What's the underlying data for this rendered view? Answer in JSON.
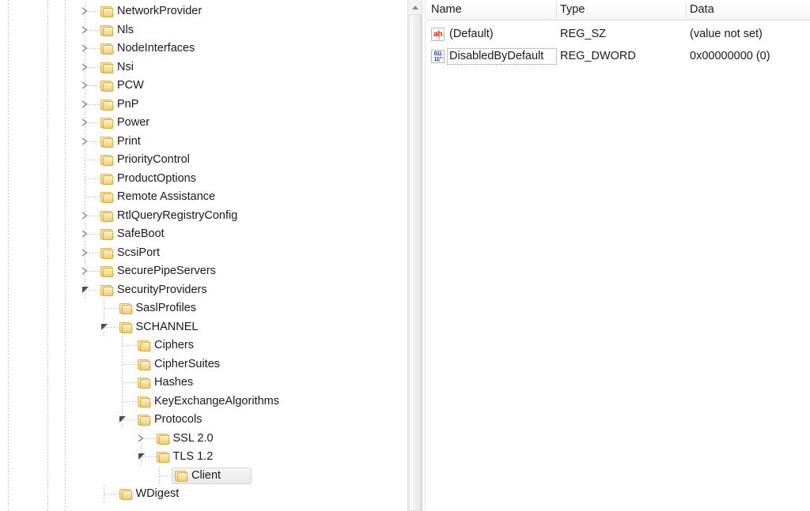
{
  "tree": {
    "scroll_up_icon": "scroll-up-arrow-icon",
    "nodes": [
      {
        "label": "NetworkProvider",
        "depth": 0,
        "state": "collapsed"
      },
      {
        "label": "Nls",
        "depth": 0,
        "state": "collapsed"
      },
      {
        "label": "NodeInterfaces",
        "depth": 0,
        "state": "collapsed"
      },
      {
        "label": "Nsi",
        "depth": 0,
        "state": "collapsed"
      },
      {
        "label": "PCW",
        "depth": 0,
        "state": "collapsed"
      },
      {
        "label": "PnP",
        "depth": 0,
        "state": "collapsed"
      },
      {
        "label": "Power",
        "depth": 0,
        "state": "collapsed"
      },
      {
        "label": "Print",
        "depth": 0,
        "state": "collapsed"
      },
      {
        "label": "PriorityControl",
        "depth": 0,
        "state": "leaf"
      },
      {
        "label": "ProductOptions",
        "depth": 0,
        "state": "leaf"
      },
      {
        "label": "Remote Assistance",
        "depth": 0,
        "state": "leaf"
      },
      {
        "label": "RtlQueryRegistryConfig",
        "depth": 0,
        "state": "collapsed"
      },
      {
        "label": "SafeBoot",
        "depth": 0,
        "state": "collapsed"
      },
      {
        "label": "ScsiPort",
        "depth": 0,
        "state": "collapsed"
      },
      {
        "label": "SecurePipeServers",
        "depth": 0,
        "state": "collapsed"
      },
      {
        "label": "SecurityProviders",
        "depth": 0,
        "state": "expanded"
      },
      {
        "label": "SaslProfiles",
        "depth": 1,
        "state": "leaf"
      },
      {
        "label": "SCHANNEL",
        "depth": 1,
        "state": "expanded"
      },
      {
        "label": "Ciphers",
        "depth": 2,
        "state": "leaf"
      },
      {
        "label": "CipherSuites",
        "depth": 2,
        "state": "leaf"
      },
      {
        "label": "Hashes",
        "depth": 2,
        "state": "leaf"
      },
      {
        "label": "KeyExchangeAlgorithms",
        "depth": 2,
        "state": "leaf"
      },
      {
        "label": "Protocols",
        "depth": 2,
        "state": "expanded"
      },
      {
        "label": "SSL 2.0",
        "depth": 3,
        "state": "collapsed"
      },
      {
        "label": "TLS 1.2",
        "depth": 3,
        "state": "expanded"
      },
      {
        "label": "Client",
        "depth": 4,
        "state": "leaf",
        "selected": true
      },
      {
        "label": "WDigest",
        "depth": 1,
        "state": "leaf"
      }
    ]
  },
  "values": {
    "columns": [
      {
        "key": "name",
        "label": "Name"
      },
      {
        "key": "type",
        "label": "Type"
      },
      {
        "key": "data",
        "label": "Data"
      }
    ],
    "rows": [
      {
        "name": "(Default)",
        "type": "REG_SZ",
        "data": "(value not set)",
        "icon": "string-value-icon",
        "icon_glyph": "ab",
        "focused": false
      },
      {
        "name": "DisabledByDefault",
        "type": "REG_DWORD",
        "data": "0x00000000 (0)",
        "icon": "dword-value-icon",
        "icon_glyph_top": "011",
        "icon_glyph_bottom": "110",
        "focused": true
      }
    ]
  },
  "colors": {
    "string_icon": "#cc2200",
    "dword_icon": "#1c36b5",
    "folder": "#f7dd99",
    "text": "#1a1a1a",
    "selection_bg": "#eaeaea"
  }
}
